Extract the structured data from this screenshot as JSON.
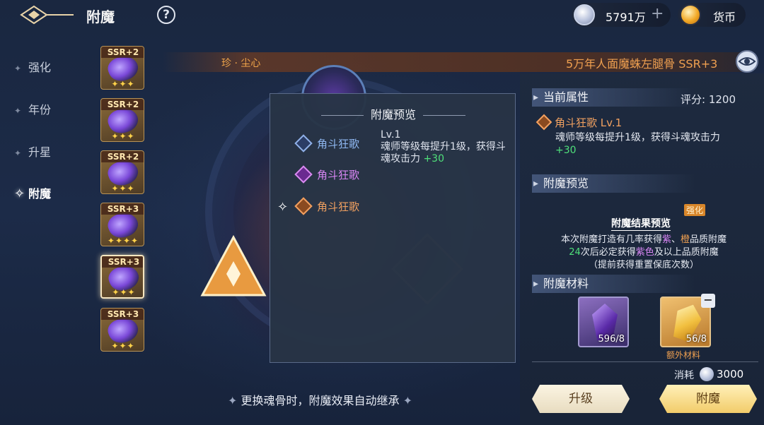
{
  "header": {
    "title": "附魔",
    "help_label": "?",
    "currency_amount": "5791万",
    "currency_label": "货币"
  },
  "tabs": [
    {
      "label": "强化"
    },
    {
      "label": "年份"
    },
    {
      "label": "升星"
    },
    {
      "label": "附魔"
    }
  ],
  "cards": [
    {
      "badge": "SSR+2",
      "stars": "✦✦✦"
    },
    {
      "badge": "SSR+2",
      "stars": "✦✦✦"
    },
    {
      "badge": "SSR+2",
      "stars": "✦✦✦"
    },
    {
      "badge": "SSR+3",
      "stars": "✦✦✦✦"
    },
    {
      "badge": "SSR+3",
      "stars": "✦✦✦"
    },
    {
      "badge": "SSR+3",
      "stars": "✦✦✦"
    }
  ],
  "banner": {
    "quality": "珍 · 尘心",
    "item_name": "5万年人面魔蛛左腿骨 SSR+3"
  },
  "popup": {
    "title": "附魔预览",
    "rows": [
      {
        "name": "角斗狂歌",
        "color": "blue"
      },
      {
        "name": "角斗狂歌",
        "color": "purple"
      },
      {
        "name": "角斗狂歌",
        "color": "orange"
      }
    ],
    "detail_level": "Lv.1",
    "detail_text": "魂师等级每提升1级，获得斗魂攻击力",
    "detail_bonus": "+30"
  },
  "right": {
    "current_attr_title": "当前属性",
    "score": "评分: 1200",
    "attr_name": "角斗狂歌 Lv.1",
    "attr_desc": "魂师等级每提升1级，获得斗魂攻击力",
    "attr_bonus": "+30",
    "preview_title": "附魔预览",
    "result_title": "附魔结果预览",
    "result_badge": "强化",
    "result_line1_a": "本次附魔打造有几率获得",
    "result_line1_purple": "紫",
    "result_line1_sep": "、",
    "result_line1_orange": "橙",
    "result_line1_b": "品质附魔",
    "result_line2_num": "24",
    "result_line2_a": "次后必定获得",
    "result_line2_purple": "紫色",
    "result_line2_b": "及以上品质附魔",
    "result_line3": "（提前获得重置保底次数）",
    "materials_title": "附魔材料",
    "materials": [
      {
        "count": "596/8"
      },
      {
        "count": "56/8",
        "label": "额外材料"
      }
    ],
    "cost_label": "消耗",
    "cost_value": "3000",
    "upgrade_button": "升级",
    "enchant_button": "附魔"
  },
  "tip": "更换魂骨时，附魔效果自动继承",
  "colors": {
    "accent_orange": "#f0a050",
    "purple": "#d886f4",
    "blue": "#8fb8f2",
    "green": "#4fe07a"
  }
}
